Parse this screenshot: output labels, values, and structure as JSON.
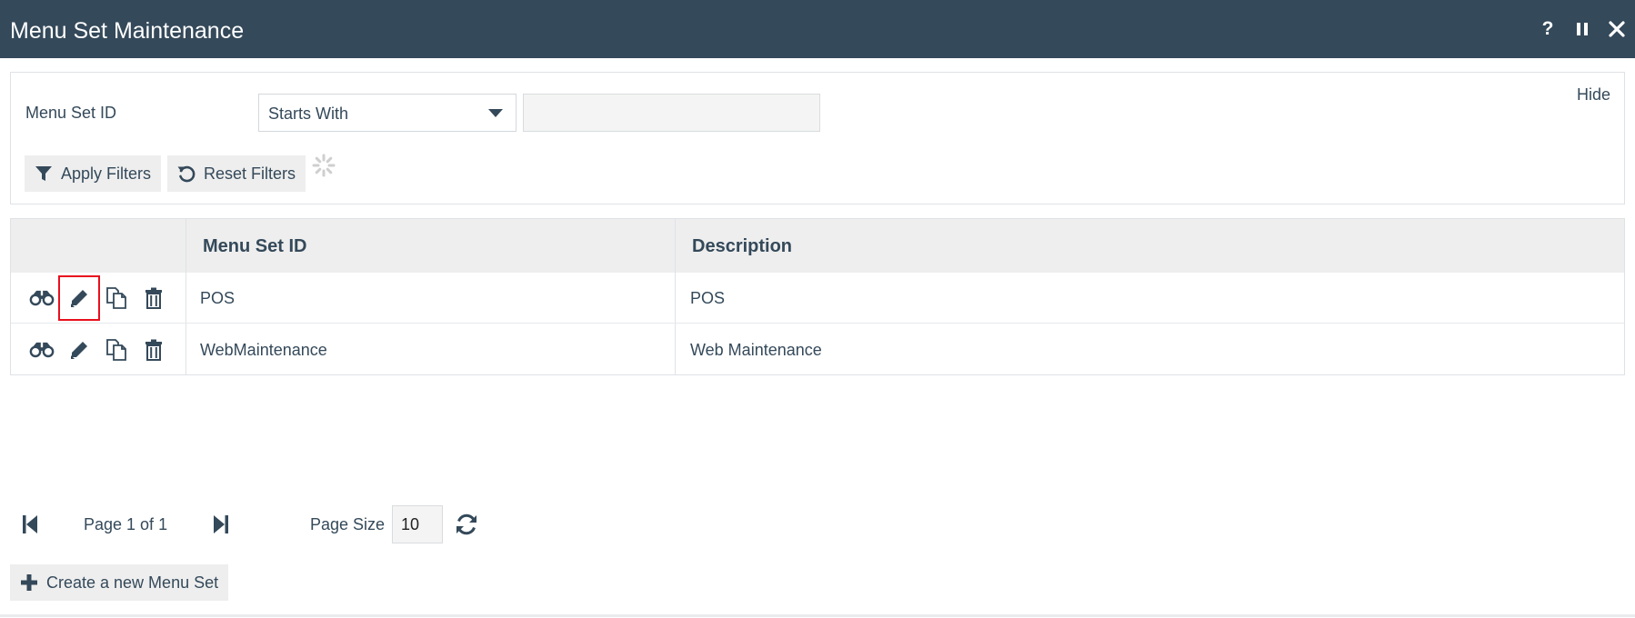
{
  "window": {
    "title": "Menu Set Maintenance",
    "help_label": "?"
  },
  "filters": {
    "field_label": "Menu Set ID",
    "operator_selected": "Starts With",
    "value": "",
    "hide_label": "Hide",
    "apply_label": "Apply Filters",
    "reset_label": "Reset Filters"
  },
  "grid": {
    "columns": [
      "Menu Set ID",
      "Description"
    ],
    "rows": [
      {
        "id": "POS",
        "description": "POS"
      },
      {
        "id": "WebMaintenance",
        "description": "Web Maintenance"
      }
    ],
    "row_actions": [
      "binoculars-icon",
      "pencil-icon",
      "copy-icon",
      "trash-icon"
    ],
    "highlighted_action": {
      "row": 0,
      "action": "pencil-icon",
      "color": "#e8101e"
    }
  },
  "pager": {
    "page_text": "Page 1 of 1",
    "page_size_label": "Page Size",
    "page_size": "10"
  },
  "create_label": "Create a new Menu Set",
  "colors": {
    "titlebar": "#34495a",
    "button_bg": "#eeeeee",
    "text": "#34495a"
  }
}
